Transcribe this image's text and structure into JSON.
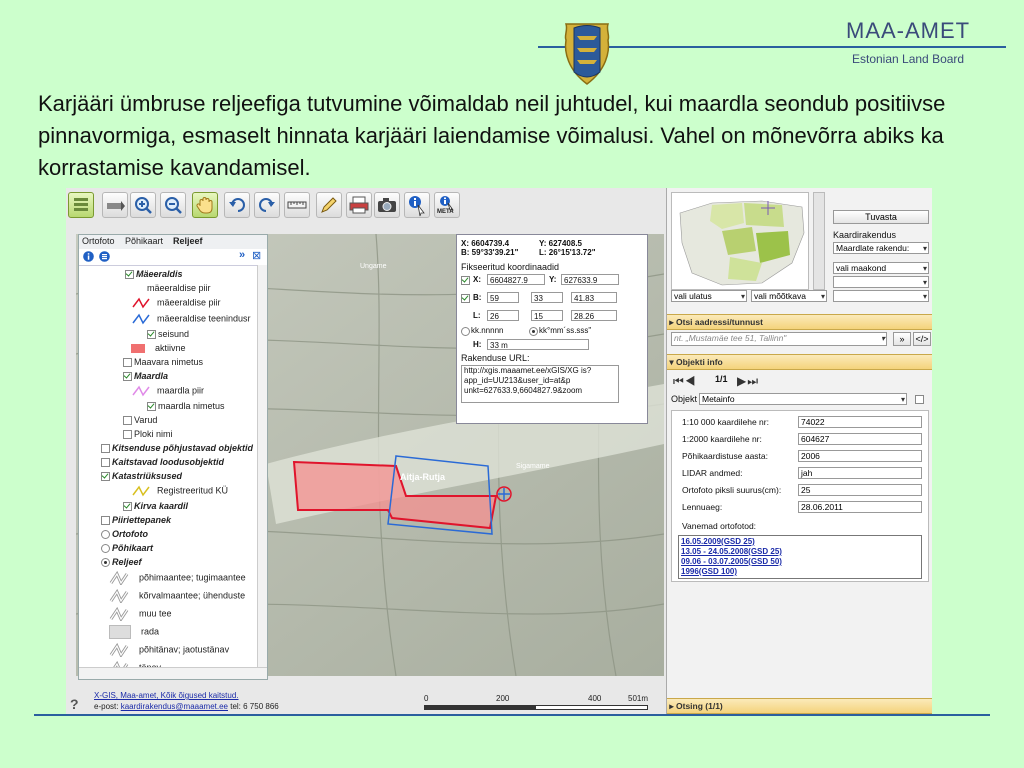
{
  "brand": {
    "title": "MAA-AMET",
    "subtitle": "Estonian Land Board"
  },
  "slide_text": "Karjääri ümbruse reljeefiga tutvumine võimaldab neil juhtudel, kui maardla seondub positiivse pinnavormiga, esmaselt hinnata karjääri laiendamise võimalusi. Vahel on mõnevõrra abiks ka korrastamise kavandamisel.",
  "toolbar": {
    "meta_label": "META",
    "icons": [
      "layers-icon",
      "pan-back-icon",
      "zoom-in-icon",
      "zoom-out-icon",
      "hand-icon",
      "undo-icon",
      "redo-icon",
      "measure-icon",
      "pencil-icon",
      "print-icon",
      "camera-icon",
      "info-icon",
      "meta-info-icon"
    ]
  },
  "layer_panel": {
    "tabs": [
      "Ortofoto",
      "Põhikaart",
      "Reljeef"
    ],
    "rows": [
      {
        "label": "Mäeeraldis",
        "type": "check",
        "on": true,
        "bold": true
      },
      {
        "label": "mäeeraldise piir",
        "type": "plain"
      },
      {
        "label": "mäeeraldise piir",
        "type": "legend-red"
      },
      {
        "label": "mäeeraldise teenindusr",
        "type": "legend-blue"
      },
      {
        "label": "seisund",
        "type": "check",
        "on": true
      },
      {
        "label": "aktiivne",
        "type": "legend-fill"
      },
      {
        "label": "Maavara nimetus",
        "type": "check",
        "on": false
      },
      {
        "label": "Maardla",
        "type": "check",
        "on": true,
        "bold": true
      },
      {
        "label": "maardla piir",
        "type": "legend-pink"
      },
      {
        "label": "maardla nimetus",
        "type": "check",
        "on": true
      },
      {
        "label": "Varud",
        "type": "check",
        "on": false
      },
      {
        "label": "Ploki nimi",
        "type": "check",
        "on": false
      },
      {
        "label": "Kitsenduse põhjustavad objektid",
        "type": "check",
        "on": false,
        "bold": true
      },
      {
        "label": "Kaitstavad loodusobjektid",
        "type": "check",
        "on": false,
        "bold": true
      },
      {
        "label": "Katastriüksused",
        "type": "check",
        "on": true,
        "bold": true
      },
      {
        "label": "Registreeritud KÜ",
        "type": "legend-yellow"
      },
      {
        "label": "Kirva kaardil",
        "type": "check",
        "on": true,
        "bold": true
      },
      {
        "label": "Piiriettepanek",
        "type": "check",
        "on": false,
        "bold": true
      },
      {
        "label": "Ortofoto",
        "type": "radio",
        "on": false,
        "bold": true
      },
      {
        "label": "Põhikaart",
        "type": "radio",
        "on": false,
        "bold": true
      },
      {
        "label": "Reljeef",
        "type": "radio",
        "on": true,
        "bold": true
      },
      {
        "label": "põhimaantee; tugimaantee",
        "type": "legend-road"
      },
      {
        "label": "kõrvalmaantee; ühenduste",
        "type": "legend-road"
      },
      {
        "label": "muu tee",
        "type": "legend-road"
      },
      {
        "label": "rada",
        "type": "legend-box"
      },
      {
        "label": "põhitänav; jaotustänav",
        "type": "legend-road"
      },
      {
        "label": "tänav",
        "type": "legend-road"
      }
    ]
  },
  "coords": {
    "x_label": "X: 6604739.4",
    "y_label": "Y: 627408.5",
    "b_label": "B: 59°33'39.21\"",
    "l_label": "L: 26°15'13.72\"",
    "fixed_title": "Fikseeritud koordinaadid",
    "x_key": "X:",
    "x_val": "6604827.9",
    "y_key": "Y:",
    "y_val": "627633.9",
    "b_key": "B:",
    "b_deg": "59",
    "b_min": "33",
    "b_sec": "41.83",
    "l_key": "L:",
    "l_deg": "26",
    "l_min": "15",
    "l_sec": "28.26",
    "fmt1": "kk.nnnnn",
    "fmt2": "kk°mm´ss.sss\"",
    "h_key": "H:",
    "h_val": "33 m",
    "url_title": "Rakenduse URL:",
    "url_val": "http://xgis.maaamet.ee/xGIS/XG is?app_id=UU213&user_id=at&p unkt=627633.9,6604827.9&zoom"
  },
  "map": {
    "label_deposit": "Aitja-Rutja",
    "label_place1": "Ungame",
    "label_place2": "Sigamame"
  },
  "right_panel": {
    "tuvasta": "Tuvasta",
    "kaardirakendus_label": "Kaardirakendus",
    "app_select": "Maardlate rakendu:",
    "county_select": "vali maakond",
    "scope_select": "vali ulatus",
    "scale_select": "vali mõõtkava",
    "address_header": "Otsi aadressi/tunnust",
    "address_placeholder": "nt. „Mustamäe tee 51, Tallinn\"",
    "object_header": "Objekti info",
    "pager": "1/1",
    "object_label": "Objekt",
    "object_select": "Metainfo",
    "info": [
      {
        "label": "1:10 000 kaardilehe nr:",
        "value": "74022"
      },
      {
        "label": "1:2000 kaardilehe nr:",
        "value": "604627"
      },
      {
        "label": "Põhikaardistuse aasta:",
        "value": "2006"
      },
      {
        "label": "LIDAR andmed:",
        "value": "jah"
      },
      {
        "label": "Ortofoto piksli suurus(cm):",
        "value": "25"
      },
      {
        "label": "Lennuaeg:",
        "value": "28.06.2011"
      }
    ],
    "older_label": "Vanemad ortofotod:",
    "older_links": [
      "16.05.2009(GSD 25)",
      "13.05 - 24.05.2008(GSD 25)",
      "09.06 - 03.07.2005(GSD 50)",
      "1996(GSD 100)"
    ],
    "search_header": "Otsing (1/1)"
  },
  "footer": {
    "copyright": "X-GIS, Maa-amet, Kõik õigused kaitstud.",
    "email_label": "e-post:",
    "email": "kaardirakendus@maaamet.ee",
    "phone": "tel: 6 750 866",
    "scale_0": "0",
    "scale_200": "200",
    "scale_400": "400",
    "scale_501": "501m"
  }
}
